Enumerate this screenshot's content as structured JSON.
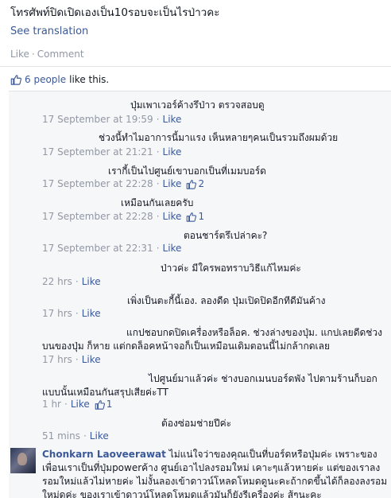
{
  "post": {
    "text": "โทรศัพท์ปิดเปิดเองเป็น10รอบจะเป็นไรป่าวคะ",
    "see_translation": "See translation",
    "like_label": "Like",
    "separator": "·",
    "comment_label": "Comment"
  },
  "likes_summary": {
    "people": "6 people",
    "suffix": "like this."
  },
  "comments": [
    {
      "text": "ปุ่มเพาเวอร์ค้างรึป่าว ตรวจสอบดู",
      "time": "17 September at 19:59",
      "like": "Like",
      "likes": ""
    },
    {
      "text": "ช่วงนี้ทำไมอาการนี้มาแรง เห็นหลายๆคนเป็นรวมถึงผมด้วย",
      "time": "17 September at 21:21",
      "like": "Like",
      "likes": ""
    },
    {
      "text": "เรากี้เป็นไปศูนย์เขาบอกเป็นที่เมมบอร์ด",
      "time": "17 September at 22:28",
      "like": "Like",
      "likes": "2"
    },
    {
      "text": "เหมือนกันเลยครับ",
      "time": "17 September at 22:28",
      "like": "Like",
      "likes": "1"
    },
    {
      "text": "ตอนชาร์ตรึเปล่าคะ?",
      "time": "17 September at 22:31",
      "like": "Like",
      "likes": ""
    },
    {
      "text": "ป่าวค่ะ มีใครพอทราบวิธีแก้ไหมค่ะ",
      "time": "22 hrs",
      "like": "Like",
      "likes": ""
    },
    {
      "text": "เพิ่งเป็นตะกี้นี้เอง. ลองดีด ปุ่มเปิดปิดอีกทีดีมันค้าง",
      "time": "17 hrs",
      "like": "Like",
      "likes": ""
    },
    {
      "text_line1": "แกปชอบกดปิดเครื่องหรือล็อค. ช่วงล่างของปุ่ม. แกปเลยดีดช่วง",
      "text_line2": "บนของปุ่ม ก็หาย แต่กดล็อคหน้าจอก็เป็นเหมือนเดิมตอนนี้ไม่กล้ากดเลย",
      "time": "17 hrs",
      "like": "Like",
      "likes": ""
    },
    {
      "text_line1": "ไปศูนย์มาแล้วค่ะ ช่างบอกเมนบอร์ดพัง ไปตามร้านก็บอก",
      "text_line2": "แบบนั้นเหมือนกันสรุปเสียค่ะTT",
      "time": "1 hr",
      "like": "Like",
      "likes": "1"
    },
    {
      "text": "ต้องซ่อมช่ายปีค่ะ",
      "time": "51 mins",
      "like": "Like",
      "likes": ""
    }
  ],
  "last_comment": {
    "author": "Chonkarn Laoveerawat",
    "text": "ไม่แน่ใจว่าของคุณเป็นที่บอร์ดหรือปุ่มค่ะ เพราะของเพื่อนเราเป็นที่ปุ่มpowerค้าง ศูนย์เอาไปลงรอมใหม่ เคาะๆแล้วหายค่ะ แต่ของเราลงรอมใหม่แล้วไม่หายค่ะ ไม่งั้นลองเข้าดาวน์โหลดโหมดดูนะคะถ้ากดขึ้นได้ก็ลองลงรอมใหม่ดูค่ะ ของเราเข้าดาวน์โหลดโหมดแล้วมันก็ยังรีเครื่องค่ะ สู้ๆนะคะ"
  },
  "colors": {
    "link": "#3b5998",
    "meta": "#9197a3",
    "comments_bg": "#f6f7f9"
  }
}
